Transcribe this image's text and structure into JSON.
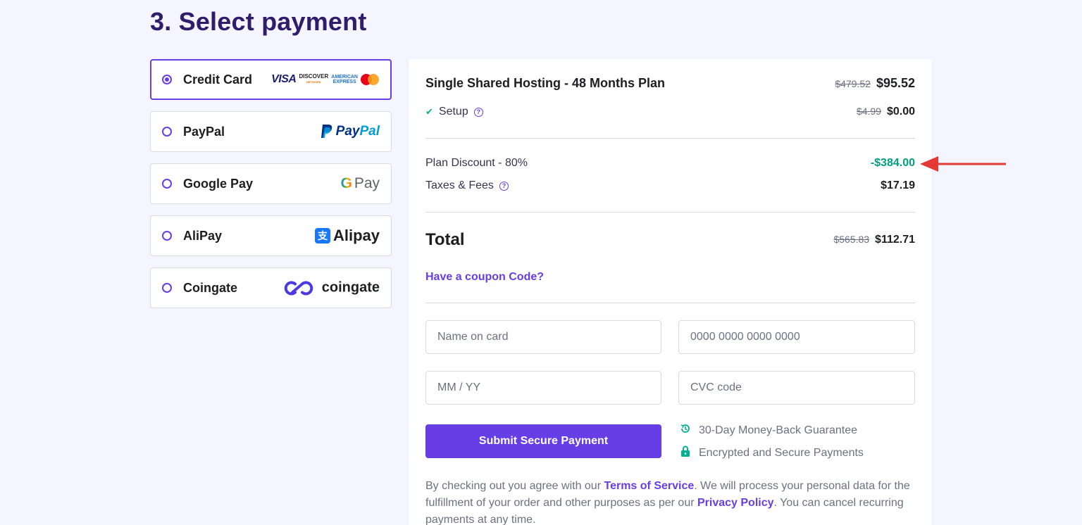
{
  "heading": "3. Select payment",
  "methods": [
    {
      "label": "Credit Card",
      "selected": true
    },
    {
      "label": "PayPal",
      "selected": false
    },
    {
      "label": "Google Pay",
      "selected": false
    },
    {
      "label": "AliPay",
      "selected": false
    },
    {
      "label": "Coingate",
      "selected": false
    }
  ],
  "logos": {
    "visa": "VISA",
    "discover": "DISCOVER",
    "discover_sub": "NETWORK",
    "amex_line1": "AMERICAN",
    "amex_line2": "EXPRESS",
    "paypal_pay": "Pay",
    "paypal_pal": "Pal",
    "gpay_g": "G",
    "gpay_pay": "Pay",
    "alipay": "Alipay",
    "alipay_icon": "支",
    "coingate": "coingate"
  },
  "summary": {
    "plan_name": "Single Shared Hosting - 48 Months Plan",
    "plan_old_price": "$479.52",
    "plan_price": "$95.52",
    "setup_label": "Setup",
    "setup_old_price": "$4.99",
    "setup_price": "$0.00",
    "discount_label": "Plan Discount - 80%",
    "discount_value": "-$384.00",
    "taxes_label": "Taxes & Fees",
    "taxes_value": "$17.19",
    "total_label": "Total",
    "total_old": "$565.83",
    "total_value": "$112.71",
    "coupon_link": "Have a coupon Code?"
  },
  "form": {
    "name_placeholder": "Name on card",
    "card_placeholder": "0000 0000 0000 0000",
    "expiry_placeholder": "MM / YY",
    "cvc_placeholder": "CVC code",
    "submit_label": "Submit Secure Payment"
  },
  "guarantees": {
    "money_back": "30-Day Money-Back Guarantee",
    "secure": "Encrypted and Secure Payments"
  },
  "legal": {
    "part1": "By checking out you agree with our ",
    "terms": "Terms of Service",
    "part2": ". We will process your personal data for the fulfillment of your order and other purposes as per our ",
    "privacy": "Privacy Policy",
    "part3": ". You can cancel recurring payments at any time."
  },
  "colors": {
    "accent": "#673de6",
    "discount_green": "#00a07e",
    "annotation_arrow": "#e53935"
  }
}
